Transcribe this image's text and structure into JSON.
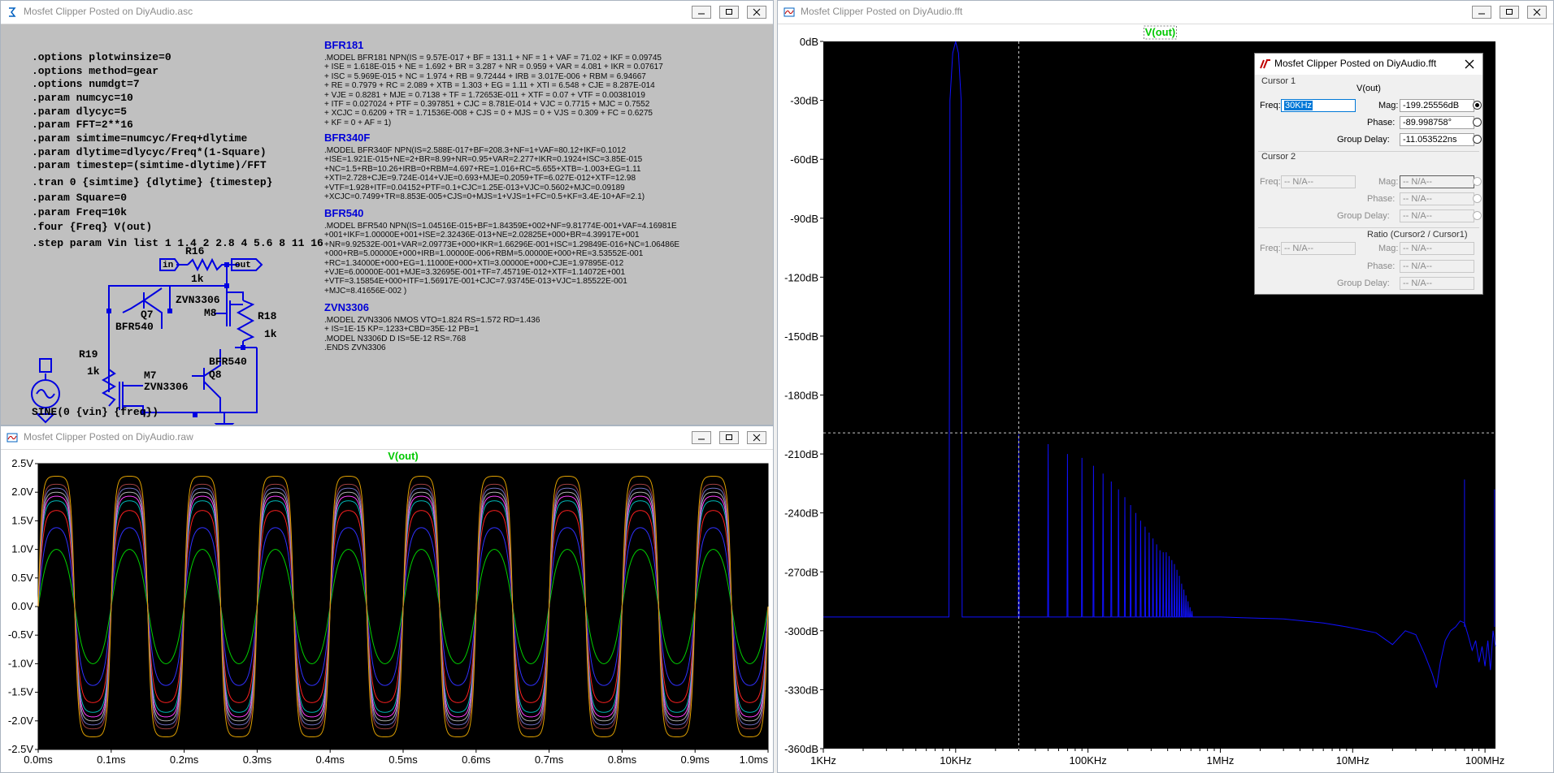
{
  "schematic_window": {
    "title": "Mosfet Clipper Posted on DiyAudio.asc",
    "directives": [
      ".options plotwinsize=0",
      ".options method=gear",
      ".options numdgt=7",
      ".param numcyc=10",
      ".param dlycyc=5",
      ".param FFT=2**16",
      ".param simtime=numcyc/Freq+dlytime",
      ".param dlytime=dlycyc/Freq*(1-Square)",
      ".param timestep=(simtime-dlytime)/FFT",
      ".tran 0 {simtime} {dlytime} {timestep}",
      ".param Square=0",
      ".param Freq=10k",
      ".four {Freq} V(out)",
      ".step param Vin list 1 1.4 2 2.8 4 5.6 8 11 16"
    ],
    "models": [
      {
        "name": "BFR181",
        "lines": [
          ".MODEL BFR181 NPN(IS = 9.57E-017 + BF = 131.1 + NF = 1 + VAF = 71.02 + IKF = 0.09745",
          "+ ISE = 1.618E-015 + NE = 1.692 + BR = 3.287 + NR = 0.959 + VAR = 4.081 + IKR = 0.07617",
          "+ ISC = 5.969E-015 + NC = 1.974 + RB = 9.72444 + IRB = 3.017E-006 + RBM = 6.94667",
          "+ RE = 0.7979 + RC = 2.089 + XTB = 1.303 + EG = 1.11 + XTI = 6.548 + CJE = 8.287E-014",
          "+ VJE = 0.8281 + MJE = 0.7138 + TF = 1.72653E-011 + XTF = 0.07 + VTF = 0.00381019",
          "+ ITF = 0.027024 + PTF = 0.397851 + CJC = 8.781E-014 + VJC = 0.7715 + MJC = 0.7552",
          "+ XCJC = 0.6209 + TR = 1.71536E-008 + CJS = 0 + MJS = 0 + VJS = 0.309 + FC = 0.6275",
          "+ KF = 0 + AF = 1)"
        ]
      },
      {
        "name": "BFR340F",
        "lines": [
          ".MODEL BFR340F NPN(IS=2.588E-017+BF=208.3+NF=1+VAF=80.12+IKF=0.1012",
          "+ISE=1.921E-015+NE=2+BR=8.99+NR=0.95+VAR=2.277+IKR=0.1924+ISC=3.85E-015",
          "+NC=1.5+RB=10.26+IRB=0+RBM=4.697+RE=1.016+RC=5.655+XTB=-1.003+EG=1.11",
          "+XTI=2.728+CJE=9.724E-014+VJE=0.693+MJE=0.2059+TF=6.027E-012+XTF=12.98",
          "+VTF=1.928+ITF=0.04152+PTF=0.1+CJC=1.25E-013+VJC=0.5602+MJC=0.09189",
          "+XCJC=0.7499+TR=8.853E-005+CJS=0+MJS=1+VJS=1+FC=0.5+KF=3.4E-10+AF=2.1)"
        ]
      },
      {
        "name": "BFR540",
        "lines": [
          ".MODEL BFR540 NPN(IS=1.04516E-015+BF=1.84359E+002+NF=9.81774E-001+VAF=4.16981E",
          "+001+IKF=1.00000E+001+ISE=2.32436E-013+NE=2.02825E+000+BR=4.39917E+001",
          "+NR=9.92532E-001+VAR=2.09773E+000+IKR=1.66296E-001+ISC=1.29849E-016+NC=1.06486E",
          "+000+RB=5.00000E+000+IRB=1.00000E-006+RBM=5.00000E+000+RE=3.53552E-001",
          "+RC=1.34000E+000+EG=1.11000E+000+XTI=3.00000E+000+CJE=1.97895E-012",
          "+VJE=6.00000E-001+MJE=3.32695E-001+TF=7.45719E-012+XTF=1.14072E+001",
          "+VTF=3.15854E+000+ITF=1.56917E-001+CJC=7.93745E-013+VJC=1.85522E-001",
          "+MJC=8.41656E-002 )"
        ]
      },
      {
        "name": "ZVN3306",
        "lines": [
          ".MODEL ZVN3306 NMOS VTO=1.824 RS=1.572 RD=1.436",
          "+ IS=1E-15 KP=.1233+CBD=35E-12 PB=1",
          ".MODEL N3306D D IS=5E-12 RS=.768",
          ".ENDS ZVN3306"
        ]
      }
    ],
    "labels": {
      "in_flag": "in",
      "out_flag": "out",
      "r16": "R16",
      "r16_val": "1k",
      "r18": "R18",
      "r18_val": "1k",
      "r19": "R19",
      "r19_val": "1k",
      "q7": "Q7",
      "q7_model": "BFR540",
      "q8": "Q8",
      "q8_model": "BFR540",
      "m7": "M7",
      "m7_model": "ZVN3306",
      "m8": "M8",
      "m8_model": "ZVN3306",
      "source": "SINE(0 {vin} {freq})"
    }
  },
  "waveform_window": {
    "title": "Mosfet Clipper Posted on DiyAudio.raw",
    "trace_label": "V(out)"
  },
  "fft_window": {
    "title": "Mosfet Clipper Posted on DiyAudio.fft",
    "trace_label": "V(out)"
  },
  "cursor_dialog": {
    "title": "Mosfet Clipper Posted on DiyAudio.fft",
    "cursor1_label": "Cursor 1",
    "trace": "V(out)",
    "freq_label": "Freq:",
    "freq_value": "30KHz",
    "mag_label": "Mag:",
    "mag_value": "-199.25556dB",
    "phase_label": "Phase:",
    "phase_value": "-89.998758°",
    "gd_label": "Group Delay:",
    "gd_value": "-11.053522ns",
    "cursor2_label": "Cursor 2",
    "na": "-- N/A--",
    "ratio_label": "Ratio (Cursor2 / Cursor1)"
  },
  "chart_data": [
    {
      "type": "line",
      "title": "V(out)",
      "xlabel": "",
      "ylabel": "",
      "x_unit": "ms",
      "xlim": [
        0,
        1.0
      ],
      "ylim": [
        -2.5,
        2.5
      ],
      "x_ticks": [
        "0.0ms",
        "0.1ms",
        "0.2ms",
        "0.3ms",
        "0.4ms",
        "0.5ms",
        "0.6ms",
        "0.7ms",
        "0.8ms",
        "0.9ms",
        "1.0ms"
      ],
      "y_ticks": [
        "2.5V",
        "2.0V",
        "1.5V",
        "1.0V",
        "0.5V",
        "0.0V",
        "-0.5V",
        "-1.0V",
        "-1.5V",
        "-2.0V",
        "-2.5V"
      ],
      "frequency_khz": 10,
      "background": "#000000",
      "series": [
        {
          "amplitude": 1.0,
          "color": "#00d000"
        },
        {
          "amplitude": 1.38,
          "color": "#3030ff"
        },
        {
          "amplitude": 1.68,
          "color": "#ff2020"
        },
        {
          "amplitude": 1.85,
          "color": "#00b8b8"
        },
        {
          "amplitude": 1.93,
          "color": "#ff40ff"
        },
        {
          "amplitude": 2.0,
          "color": "#b0b0b0"
        },
        {
          "amplitude": 2.07,
          "color": "#7070c0"
        },
        {
          "amplitude": 2.14,
          "color": "#a04040"
        },
        {
          "amplitude": 2.28,
          "color": "#e0a000"
        }
      ]
    },
    {
      "type": "line",
      "title": "V(out)",
      "xlabel": "",
      "ylabel": "",
      "x_scale": "log",
      "xlim_hz": [
        1000,
        120000000
      ],
      "ylim_db": [
        -360,
        0
      ],
      "x_ticks": [
        {
          "label": "1KHz",
          "hz": 1000
        },
        {
          "label": "10KHz",
          "hz": 10000
        },
        {
          "label": "100KHz",
          "hz": 100000
        },
        {
          "label": "1MHz",
          "hz": 1000000
        },
        {
          "label": "10MHz",
          "hz": 10000000
        },
        {
          "label": "100MHz",
          "hz": 100000000
        }
      ],
      "y_ticks": [
        "0dB",
        "-30dB",
        "-60dB",
        "-90dB",
        "-120dB",
        "-150dB",
        "-180dB",
        "-210dB",
        "-240dB",
        "-270dB",
        "-300dB",
        "-330dB",
        "-360dB"
      ],
      "noise_floor_db": -293,
      "cursor": {
        "freq_hz": 30000,
        "mag_db": -199.25556
      },
      "color": "#1010ff",
      "harmonics": [
        {
          "hz": 10000,
          "db": 0
        },
        {
          "hz": 30000,
          "db": -200
        },
        {
          "hz": 50000,
          "db": -205
        },
        {
          "hz": 70000,
          "db": -210
        },
        {
          "hz": 90000,
          "db": -212
        },
        {
          "hz": 110000,
          "db": -216
        },
        {
          "hz": 130000,
          "db": -220
        },
        {
          "hz": 150000,
          "db": -224
        },
        {
          "hz": 170000,
          "db": -228
        },
        {
          "hz": 190000,
          "db": -232
        },
        {
          "hz": 210000,
          "db": -236
        },
        {
          "hz": 230000,
          "db": -240
        },
        {
          "hz": 250000,
          "db": -244
        },
        {
          "hz": 270000,
          "db": -247
        },
        {
          "hz": 290000,
          "db": -250
        },
        {
          "hz": 310000,
          "db": -253
        },
        {
          "hz": 330000,
          "db": -256
        },
        {
          "hz": 350000,
          "db": -259
        },
        {
          "hz": 370000,
          "db": -260
        },
        {
          "hz": 390000,
          "db": -260
        },
        {
          "hz": 410000,
          "db": -262
        },
        {
          "hz": 430000,
          "db": -264
        },
        {
          "hz": 450000,
          "db": -266
        },
        {
          "hz": 470000,
          "db": -269
        },
        {
          "hz": 490000,
          "db": -272
        },
        {
          "hz": 510000,
          "db": -276
        },
        {
          "hz": 530000,
          "db": -279
        },
        {
          "hz": 550000,
          "db": -282
        },
        {
          "hz": 570000,
          "db": -285
        },
        {
          "hz": 590000,
          "db": -288
        },
        {
          "hz": 610000,
          "db": -290
        }
      ],
      "highfreq_floor": [
        {
          "hz": 1000000,
          "db": -293
        },
        {
          "hz": 3000000,
          "db": -294
        },
        {
          "hz": 6000000,
          "db": -296
        },
        {
          "hz": 9000000,
          "db": -298
        },
        {
          "hz": 15000000,
          "db": -301
        },
        {
          "hz": 20000000,
          "db": -307
        },
        {
          "hz": 25000000,
          "db": -300
        },
        {
          "hz": 30000000,
          "db": -302
        },
        {
          "hz": 35000000,
          "db": -312
        },
        {
          "hz": 40000000,
          "db": -322
        },
        {
          "hz": 43000000,
          "db": -329
        },
        {
          "hz": 46000000,
          "db": -316
        },
        {
          "hz": 50000000,
          "db": -305
        },
        {
          "hz": 55000000,
          "db": -300
        },
        {
          "hz": 60000000,
          "db": -298
        },
        {
          "hz": 65000000,
          "db": -295
        },
        {
          "hz": 70000000,
          "db": -296
        },
        {
          "hz": 75000000,
          "db": -303
        },
        {
          "hz": 80000000,
          "db": -310
        },
        {
          "hz": 85000000,
          "db": -305
        },
        {
          "hz": 90000000,
          "db": -316
        },
        {
          "hz": 95000000,
          "db": -308
        },
        {
          "hz": 100000000,
          "db": -318
        },
        {
          "hz": 105000000,
          "db": -305
        },
        {
          "hz": 110000000,
          "db": -320
        },
        {
          "hz": 115000000,
          "db": -300
        },
        {
          "hz": 120000000,
          "db": -308
        }
      ],
      "spurs": [
        {
          "hz": 70000000,
          "db": -223
        },
        {
          "hz": 118000000,
          "db": -228
        }
      ]
    }
  ]
}
